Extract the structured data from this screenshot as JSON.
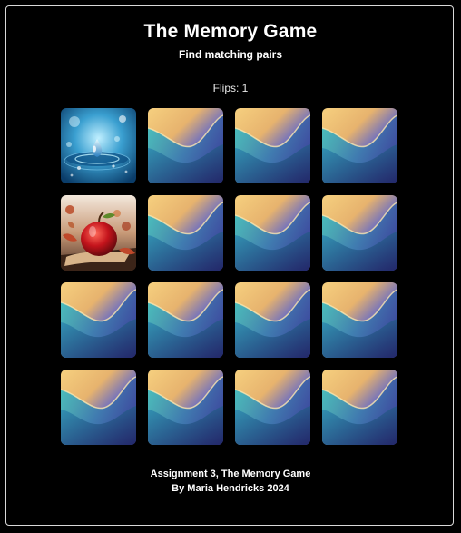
{
  "header": {
    "title": "The Memory Game",
    "subtitle": "Find matching pairs"
  },
  "status": {
    "flips_text": "Flips: 1",
    "flips": 1
  },
  "board": {
    "rows": 4,
    "columns": 4,
    "cards": [
      {
        "state": "face-up",
        "image": "water-droplet-image"
      },
      {
        "state": "face-down",
        "image": "card-back-wave"
      },
      {
        "state": "face-down",
        "image": "card-back-wave"
      },
      {
        "state": "face-down",
        "image": "card-back-wave"
      },
      {
        "state": "face-up",
        "image": "red-apple-image"
      },
      {
        "state": "face-down",
        "image": "card-back-wave"
      },
      {
        "state": "face-down",
        "image": "card-back-wave"
      },
      {
        "state": "face-down",
        "image": "card-back-wave"
      },
      {
        "state": "face-down",
        "image": "card-back-wave"
      },
      {
        "state": "face-down",
        "image": "card-back-wave"
      },
      {
        "state": "face-down",
        "image": "card-back-wave"
      },
      {
        "state": "face-down",
        "image": "card-back-wave"
      },
      {
        "state": "face-down",
        "image": "card-back-wave"
      },
      {
        "state": "face-down",
        "image": "card-back-wave"
      },
      {
        "state": "face-down",
        "image": "card-back-wave"
      },
      {
        "state": "face-down",
        "image": "card-back-wave"
      }
    ]
  },
  "footer": {
    "line1": "Assignment 3, The Memory Game",
    "line2": "By Maria Hendricks 2024"
  },
  "colors": {
    "background": "#000000",
    "border": "#d9d9d9",
    "card_back_top": "#f2c97a",
    "card_back_mid": "#39b7c2",
    "card_back_bottom": "#3a3a8a"
  }
}
